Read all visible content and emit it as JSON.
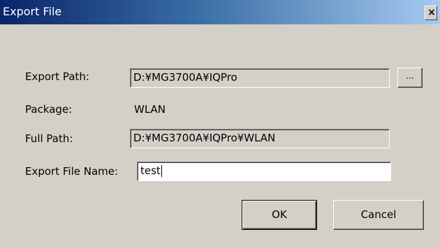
{
  "window": {
    "title": "Export File",
    "close_icon": "close-icon",
    "close_glyph": "×"
  },
  "form": {
    "export_path": {
      "label": "Export Path:",
      "value": "D:¥MG3700A¥IQPro",
      "browse_label": "..."
    },
    "package": {
      "label": "Package:",
      "value": "WLAN"
    },
    "full_path": {
      "label": "Full Path:",
      "value": "D:¥MG3700A¥IQPro¥WLAN"
    },
    "export_file_name": {
      "label": "Export File Name:",
      "value": "test"
    }
  },
  "buttons": {
    "ok": "OK",
    "cancel": "Cancel"
  },
  "colors": {
    "title_start": "#0a246a",
    "title_end": "#a6caf0",
    "dialog_bg": "#d4d0c8"
  }
}
